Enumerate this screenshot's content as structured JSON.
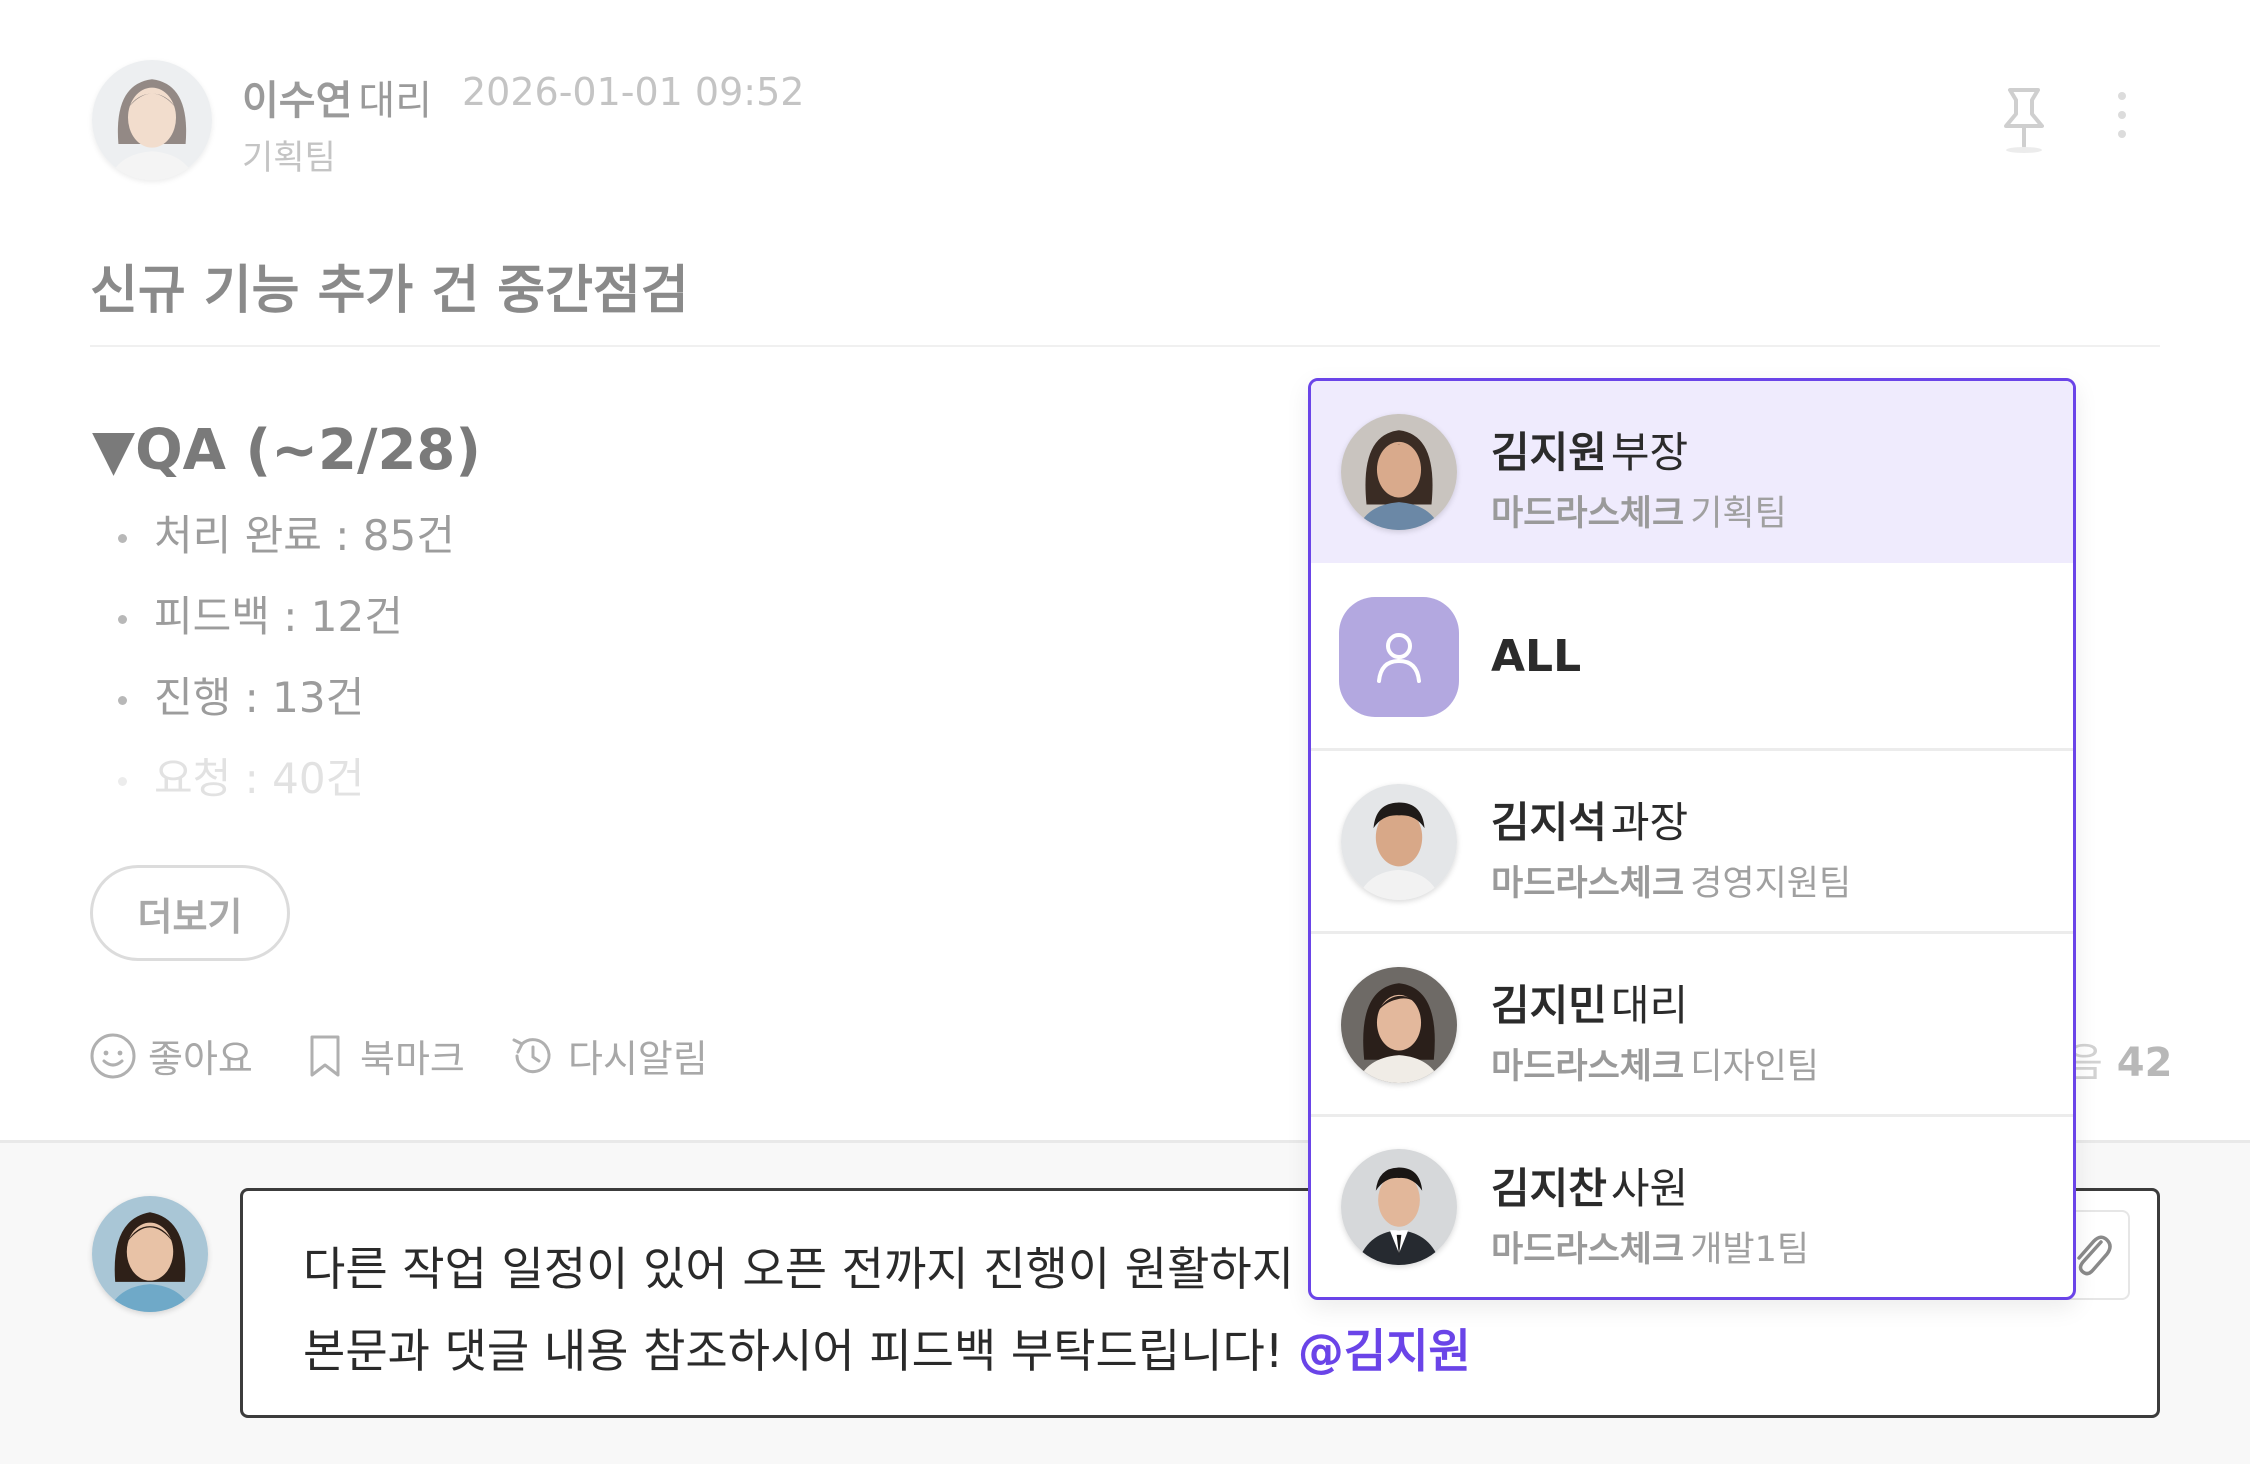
{
  "post": {
    "author": {
      "name": "이수연",
      "rank": "대리",
      "team": "기획팀",
      "time": "2026-01-01 09:52"
    },
    "title": "신규 기능 추가 건 중간점검",
    "section_title": "▼QA (~2/28)",
    "qa_items": [
      {
        "label": "처리 완료 : 85건"
      },
      {
        "label": "피드백 : 12건"
      },
      {
        "label": "진행 : 13건"
      },
      {
        "label": "요청 : 40건"
      }
    ],
    "more_label": "더보기",
    "actions": {
      "like": "좋아요",
      "bookmark": "북마크",
      "remind": "다시알림"
    },
    "read_count": {
      "prefix": "음",
      "value": "42"
    }
  },
  "comment": {
    "line_1": "다른 작업 일정이 있어 오픈 전까지 진행이 원활하지",
    "line_2": "본문과 댓글 내용 참조하시어 피드백 부탁드립니다! ",
    "mention": "@김지원"
  },
  "mention_dropdown": {
    "items": [
      {
        "name": "김지원",
        "rank": "부장",
        "company": "마드라스체크",
        "team": "기획팀"
      },
      {
        "label": "ALL"
      },
      {
        "name": "김지석",
        "rank": "과장",
        "company": "마드라스체크",
        "team": "경영지원팀"
      },
      {
        "name": "김지민",
        "rank": "대리",
        "company": "마드라스체크",
        "team": "디자인팀"
      },
      {
        "name": "김지찬",
        "rank": "사원",
        "company": "마드라스체크",
        "team": "개발1팀"
      }
    ]
  },
  "colors": {
    "accent": "#6a44e8",
    "selected_bg": "#efebfd",
    "all_avatar_bg": "#b3a8e0"
  },
  "icons": [
    "pin-icon",
    "more-vertical-icon",
    "smile-icon",
    "bookmark-icon",
    "remind-icon",
    "attach-icon",
    "person-icon"
  ]
}
